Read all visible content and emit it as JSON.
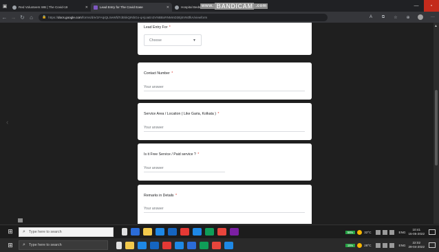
{
  "browser": {
    "tabs": [
      {
        "title": "Red Volunteers WB | The Covid-19",
        "active": false
      },
      {
        "title": "Lead Entry for The Covid Ease",
        "active": true
      },
      {
        "title": "Hospital Beds (Kolkata)",
        "active": false
      }
    ],
    "recording_watermark": {
      "www": "www.",
      "brand": "BANDICAM",
      "com": ".com"
    },
    "url": {
      "host_prefix": "https://",
      "host": "docs.google.com",
      "path": "/forms/d/e/1FAIpQLSeWfdTdEkkQINbGo-qAjUaEn3VNBBxRNMmD3Ej6VN0fkA/viewform"
    }
  },
  "form": {
    "questions": [
      {
        "title": "Lead Entry For",
        "required": "*",
        "type": "dropdown",
        "value": "Choose"
      },
      {
        "title": "Contact Number",
        "required": "*",
        "type": "short",
        "placeholder": "Your answer"
      },
      {
        "title": "Service Area / Location ( Like Garia, Kolkata )",
        "required": "*",
        "type": "short",
        "placeholder": "Your answer"
      },
      {
        "title": "Is it Free Service / Paid service ?",
        "required": "*",
        "type": "short",
        "placeholder": "Your answer"
      },
      {
        "title": "Remarks in Details",
        "required": "*",
        "type": "short",
        "placeholder": "Your answer"
      }
    ]
  },
  "taskbar_recorded": {
    "search_placeholder": "Type here to search",
    "weather": "32°C",
    "battery": "56%",
    "lang": "ENG",
    "time": "10:41",
    "date": "15-05-2022"
  },
  "taskbar": {
    "search_placeholder": "Type here to search",
    "weather": "28°C",
    "battery": "15%",
    "lang": "ENG",
    "time": "22:02",
    "date": "29-04-2022"
  },
  "colors": {
    "accent": "#673ab7",
    "required": "#d93025",
    "taskbar_app_colors": [
      "#2b6cd8",
      "#f2c94c",
      "#1e88e5",
      "#1565c0",
      "#ff7043",
      "#e53935",
      "#1e88e5",
      "#0f9d58",
      "#e8453c",
      "#7b1fa2"
    ]
  }
}
